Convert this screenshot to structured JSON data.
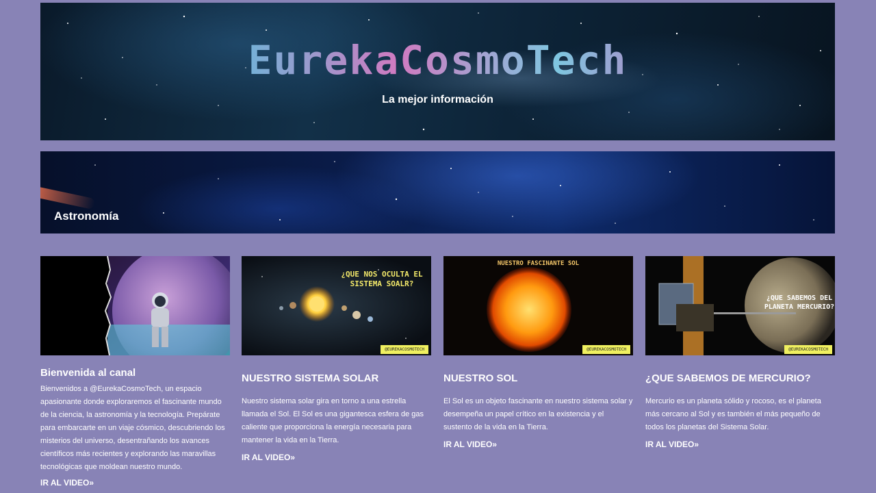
{
  "header": {
    "title": "EurekaCosmoTech",
    "subtitle": "La mejor información"
  },
  "category": {
    "label": "Astronomía"
  },
  "cards": [
    {
      "title": "Bienvenida al canal",
      "text": "Bienvenidos a @EurekaCosmoTech, un espacio apasionante donde exploraremos el fascinante mundo de la ciencia, la astronomía y la tecnología. Prepárate para embarcarte en un viaje cósmico, descubriendo los misterios del universo, desentrañando los avances científicos más recientes y explorando las maravillas tecnológicas que moldean nuestro mundo.",
      "link": "IR AL VIDEO»"
    },
    {
      "title": "NUESTRO SISTEMA SOLAR",
      "text": "Nuestro sistema solar gira en torno a una estrella llamada el Sol. El Sol es una gigantesca esfera de gas caliente que proporciona la energía necesaria para mantener la vida en la Tierra.",
      "link": "IR AL VIDEO»",
      "thumb_caption": "¿QUE NOS OCULTA EL SISTEMA SOALR?",
      "thumb_tag": "@EUREKACOSMOTECH"
    },
    {
      "title": "NUESTRO SOL",
      "text": "El Sol es un objeto fascinante en nuestro sistema solar y desempeña un papel crítico en la existencia y el sustento de la vida en la Tierra.",
      "link": "IR AL VIDEO»",
      "thumb_caption": "NUESTRO FASCINANTE SOL",
      "thumb_tag": "@EUREKACOSMOTECH"
    },
    {
      "title": "¿QUE SABEMOS DE MERCURIO?",
      "text": "Mercurio es un planeta sólido y rocoso, es el planeta más cercano al Sol y es también el más pequeño de todos los planetas del Sistema Solar.",
      "link": "IR AL VIDEO»",
      "thumb_caption": "¿QUE SABEMOS DEL PLANETA MERCURIO?",
      "thumb_tag": "@EUREKACOSMOTECH"
    }
  ],
  "colors": {
    "page_background": "#8883b6",
    "thumb_caption": "#f2e86a",
    "tag_background": "#f0f060"
  }
}
